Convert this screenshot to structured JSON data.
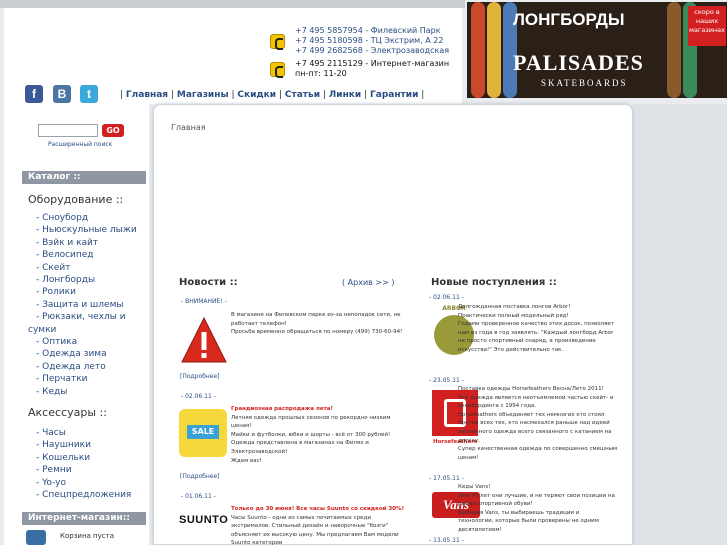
{
  "header": {
    "phones_group1": [
      "+7 495 5857954 - Филевский Парк",
      "+7 495 5180598 - ТЦ Экстрим, А 22",
      "+7 499 2682568 - Электрозаводская"
    ],
    "phones_group2": [
      "+7 495 2115129 - Интернет-магазин",
      "пн-пт: 11-20"
    ]
  },
  "social": {
    "facebook": "f",
    "vkontakte": "В",
    "twitter": "t"
  },
  "topnav": {
    "items": [
      "Главная",
      "Магазины",
      "Скидки",
      "Статьи",
      "Линки",
      "Гарантии"
    ],
    "separator": "|"
  },
  "banner": {
    "title": "ЛОНГБОРДЫ",
    "badge": "скоро в наших магазинах",
    "brand": "PALISADES",
    "brand_sub": "SKATEBOARDS"
  },
  "search": {
    "button": "GO",
    "advanced": "Расширенный поиск"
  },
  "catalog": {
    "head": "Каталог ::",
    "equipment_title": "Оборудование ::",
    "equipment": [
      "- Сноуборд",
      "- Ньюскульные лыжи",
      "- Вэйк и кайт",
      "- Велосипед",
      "- Скейт",
      "- Лонгборды",
      "- Ролики",
      "- Защита и шлемы",
      "- Рюкзаки, чехлы и",
      "сумки",
      "- Оптика",
      "- Одежда зима",
      "- Одежда лето",
      "- Перчатки",
      "- Кеды"
    ],
    "accessories_title": "Аксессуары ::",
    "accessories": [
      "- Часы",
      "- Наушники",
      "- Кошельки",
      "- Ремни",
      "- Yo-yo",
      "- Спецпредложения"
    ],
    "shop_head": "Интернет-магазин::",
    "cart": "Корзина пуста"
  },
  "breadcrumb": "Главная",
  "news": {
    "title": "Новости ::",
    "archive": "( Архив >> )",
    "items": [
      {
        "date": "- ВНИМАНИЕ! -",
        "lines": [
          "В магазине на Филевском парке из-за неполадок сети, не",
          "работает телефон!",
          "Просьба временно обращаться по номеру (499) 730-60-94!"
        ],
        "more": "[Подробнее]"
      },
      {
        "date": "- 02.06.11 -",
        "headline": "Грандиозная распродажа лета!",
        "lines": [
          "Летняя одежда прошлых сезонов по рекордно низким",
          "ценам!",
          "Майки и футболки, юбки и шорты - всё от 300 рублей!",
          "Одежда представлена в магазинах на Филях и",
          "Электрозаводской!",
          "Ждем вас!"
        ],
        "more": "[Подробнее]"
      },
      {
        "date": "- 01.06.11 -",
        "headline": "Только до 30 июня! Все часы Suunto со скидкой 30%!",
        "lines": [
          "Часы   Suunto  - одни из самых почитаемых среди",
          "экстрималов. Стильный дизайн и наворочные \"бозги\"",
          "объясняет их высокую цену. Мы предлагаем Вам модели Suunto категории"
        ]
      }
    ]
  },
  "arrivals": {
    "title": "Новые поступления ::",
    "items": [
      {
        "date": "- 02.06.11 -",
        "lines": [
          "Долгожданная поставка лонгов Arbor!",
          "Практически полный модельный ряд!",
          "Годами проверенное качество этих досок, позволяет",
          "нам из года в год заявлять: \"Каждый лонгборд  Arbor",
          "не просто спортивный снаряд, а произведение",
          "искусства!\" Это действительно так."
        ],
        "logo": "ARBOR"
      },
      {
        "date": "- 23.05.11 -",
        "lines": [
          "Поставка одежды Horsefeathers Весна/Лето 2011!",
          "Эта одежда является неотъемлемой частью скейт- и",
          "сноубординга с 1994 года.",
          "Horsefeathers объединяет тех немногих кто стоял",
          "против всех тех, кто насмехался раньше над идеей",
          "неоконного одежда всего связанного с катанием на",
          "досках.",
          "Супер качественная одежда по совершенно смешным",
          "ценам!"
        ],
        "logo": "Horsefeathers"
      },
      {
        "date": "- 17.05.11 -",
        "lines": [
          "Кеды Vans!",
          "Уже 45 лет они лучшие, и не теряют свои позиции на",
          "рынке спортивной обуви!",
          "Выбирая Vans, ты выбираешь традиции и",
          "технологии, которые были проверены не одним десятилетием!"
        ],
        "logo": "Vans"
      },
      {
        "date": "- 13.05.11 -"
      }
    ]
  },
  "brand_logos": {
    "suunto": "SUUNTO",
    "sale": "SALE"
  },
  "colors": {
    "accent": "#2a4d83",
    "red": "#d21f1f",
    "panel": "#8f97a3"
  }
}
